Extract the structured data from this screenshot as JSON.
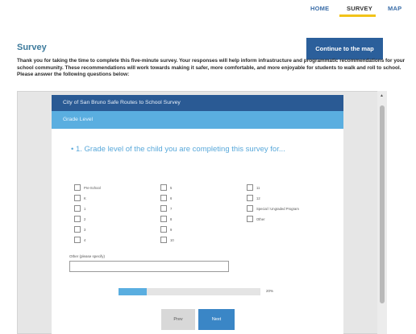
{
  "nav": {
    "home": "HOME",
    "survey": "SURVEY",
    "map": "MAP",
    "active": "SURVEY"
  },
  "header": {
    "title": "Survey",
    "cta": "Continue to the map",
    "intro": "Thank you for taking the time to complete this five-minute survey. Your responses will help inform infrastructure and programmatic recommendations for your school community. These recommendations will work towards making it safer, more comfortable, and more enjoyable for students to walk and roll to school. Please answer the following questions below:"
  },
  "survey": {
    "title": "City of San Bruno Safe Routes to School Survey",
    "section": "Grade Level",
    "question": "• 1. Grade level of the child you are completing this survey for...",
    "options_col1": [
      "Pre-School",
      "K",
      "1",
      "2",
      "3",
      "4"
    ],
    "options_col2": [
      "5",
      "6",
      "7",
      "8",
      "9",
      "10"
    ],
    "options_col3": [
      "11",
      "12",
      "Special / Ungraded Program",
      "Other"
    ],
    "other_label": "Other (please specify)",
    "other_value": "",
    "progress_percent": 20,
    "progress_text": "20%",
    "prev": "Prev",
    "next": "Next"
  },
  "colors": {
    "nav_link": "#3b6ea8",
    "nav_underline": "#f2c318",
    "cta": "#2b5f9b",
    "survey_header": "#2a5a94",
    "section_bar": "#5aaee0",
    "question": "#58a8da",
    "next_button": "#3a86c6"
  }
}
